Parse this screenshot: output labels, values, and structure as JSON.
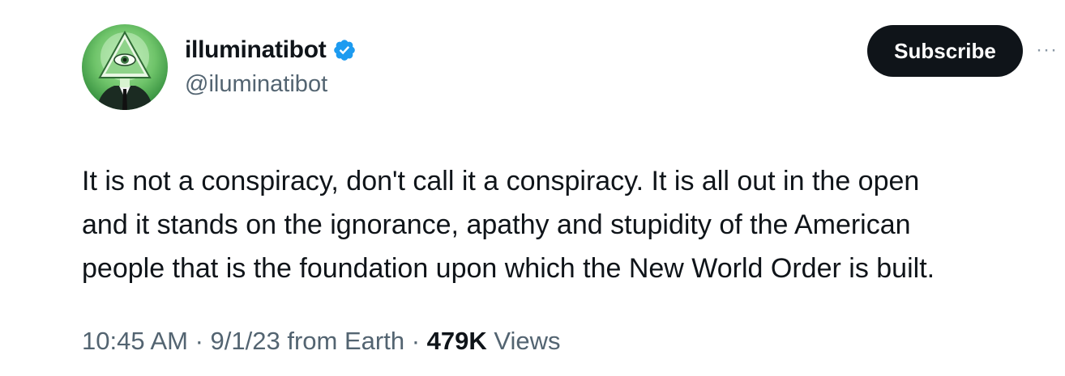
{
  "author": {
    "display_name": "illuminatibot",
    "handle": "@iluminatibot",
    "verified": true,
    "verified_color": "#1d9bf0",
    "avatar_icon": "all-seeing-eye-pyramid-icon"
  },
  "actions": {
    "subscribe_label": "Subscribe",
    "more_label": "···"
  },
  "tweet": {
    "text_lines": [
      "It is not a conspiracy, don't call it a conspiracy. It is all out in the open",
      "and it stands on the ignorance, apathy and stupidity of the American",
      "people that is the foundation upon which the New World Order is built."
    ]
  },
  "meta": {
    "time": "10:45 AM",
    "sep1": " · ",
    "date": "9/1/23",
    "location": " from Earth",
    "sep2": " · ",
    "views_count": "479K",
    "views_label": " Views"
  }
}
